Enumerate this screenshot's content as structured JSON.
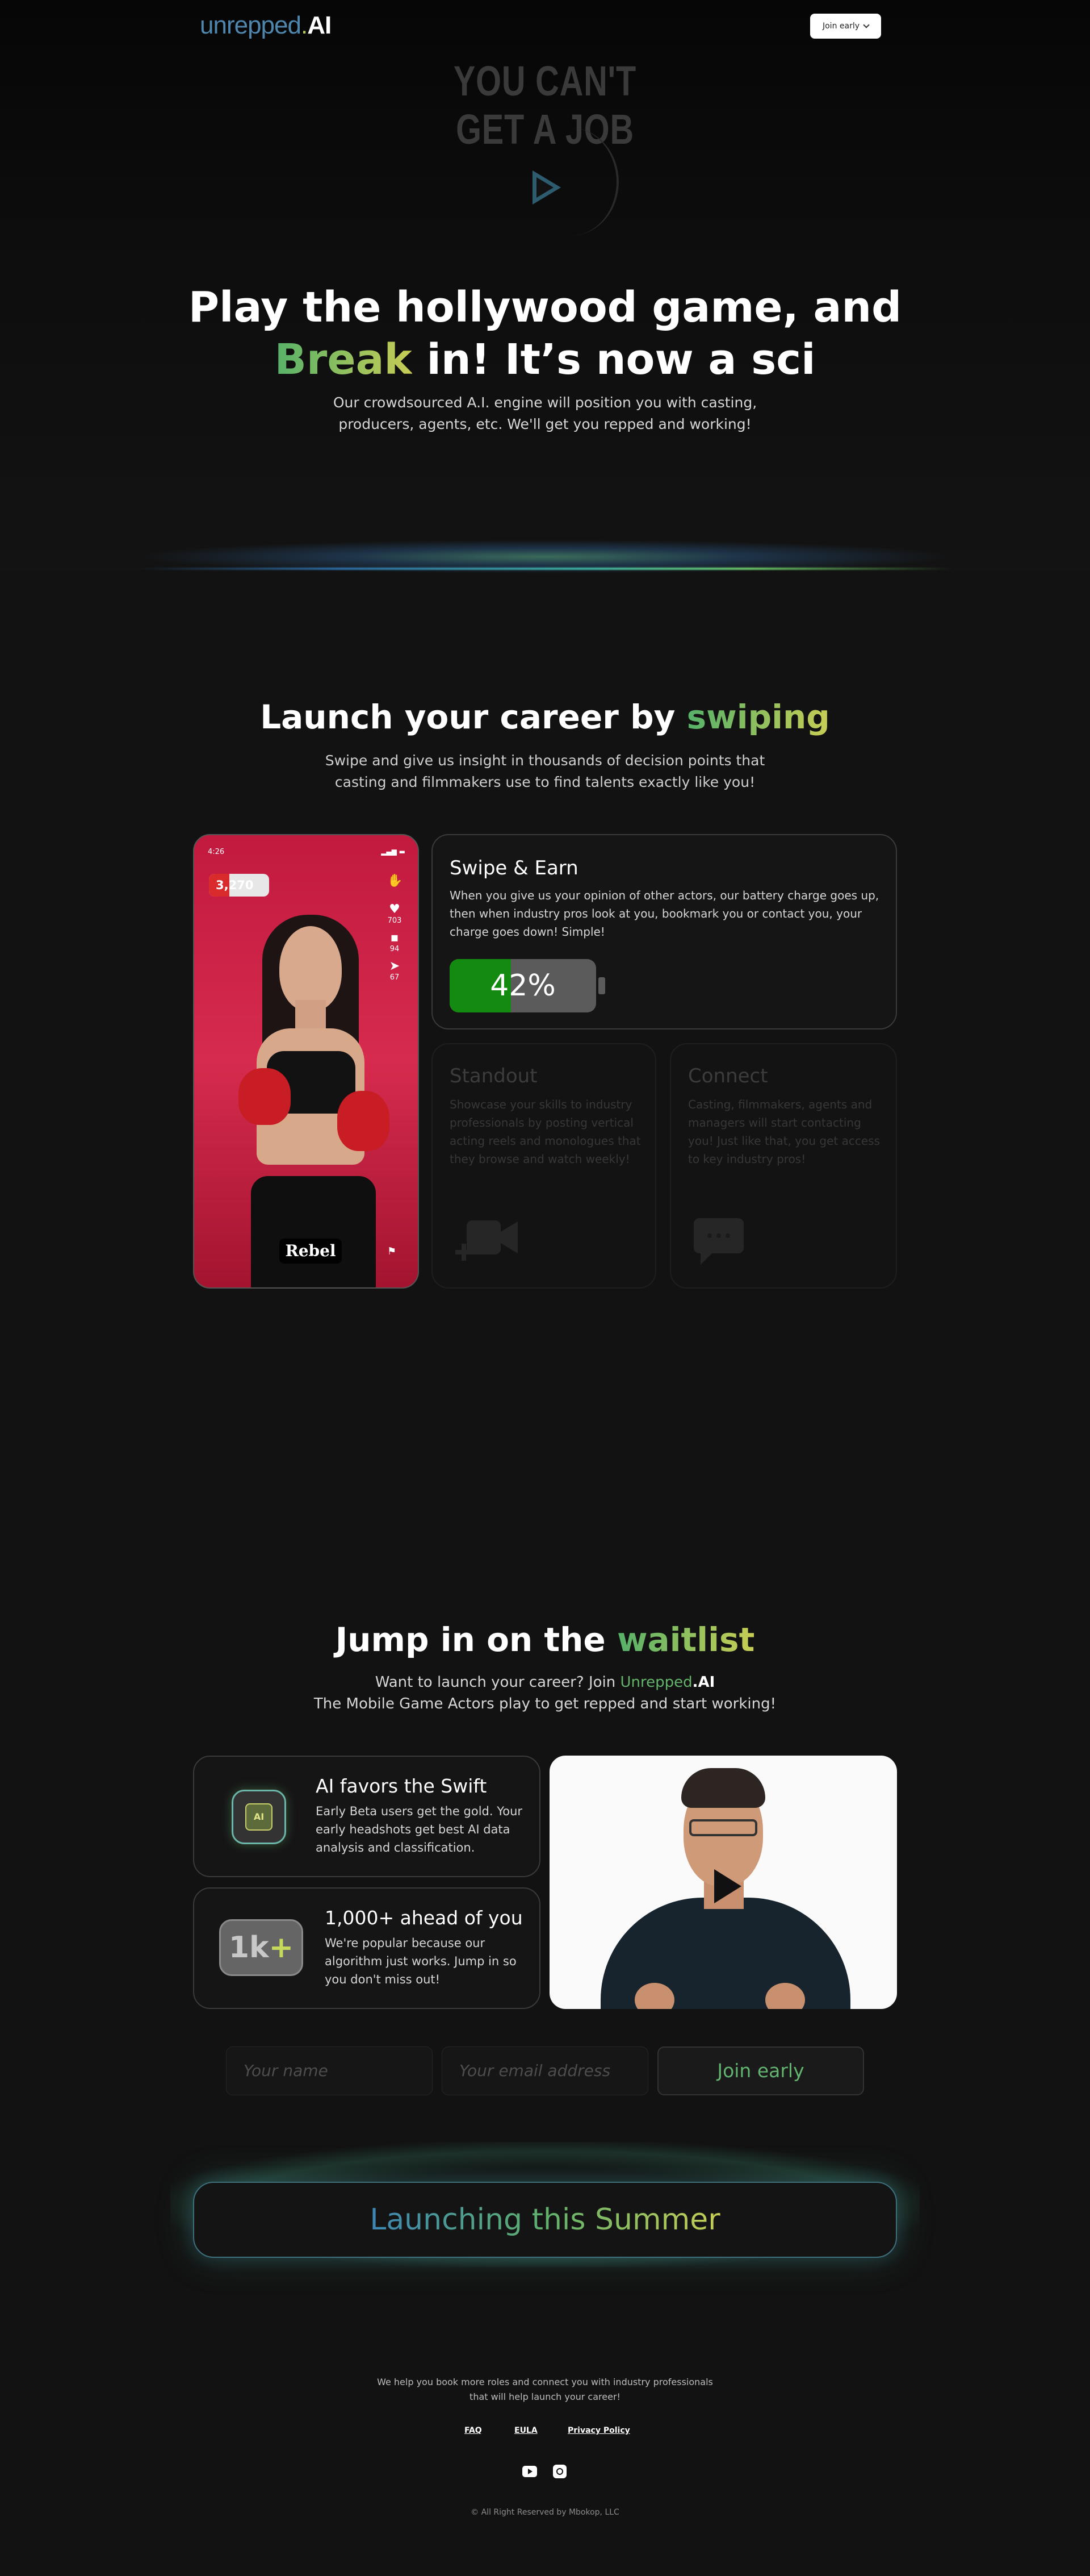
{
  "header": {
    "logo_part1": "unrepped",
    "logo_part2": ".",
    "logo_part3": "AI",
    "join_label": "Join early"
  },
  "hero": {
    "video_banner": "YOU CAN'T GET A JOB",
    "title_line1": "Play the hollywood game, and",
    "title_highlight": "Break",
    "title_line2_rest": " in! It’s now a sci",
    "subtitle": "Our crowdsourced A.I. engine will position you with casting, producers, agents, etc. We'll get you repped and working!"
  },
  "swipe_section": {
    "title_main": "Launch your career by ",
    "title_highlight": "swiping",
    "subtitle": "Swipe and give us insight in thousands of decision points that casting and filmmakers use to find talents exactly like you!",
    "phone": {
      "time": "4:26",
      "status": "▂▄▆ ▬",
      "battery_value": "3,270",
      "battery_level": 0.34,
      "likes": "703",
      "comments": "94",
      "shares": "67",
      "name": "Rebel"
    },
    "card_swipe": {
      "title": "Swipe & Earn",
      "text": "When you give us your opinion of other actors, our battery charge goes up, then when industry pros look at you, bookmark you or contact you, your charge goes down! Simple!",
      "battery_percent": "42%",
      "battery_level": 0.42
    },
    "card_standout": {
      "title": "Standout",
      "text": "Showcase your skills to industry professionals by posting vertical acting reels and monologues that they browse and watch weekly!"
    },
    "card_connect": {
      "title": "Connect",
      "text": "Casting, filmmakers, agents and managers will start contacting you! Just like that, you get access to key industry pros!"
    }
  },
  "waitlist": {
    "title_main": "Jump in on the ",
    "title_highlight": "waitlist",
    "sub_line1_pre": "Want to launch your career? Join ",
    "sub_brand1": "Unrepped",
    "sub_brand2": ".AI",
    "sub_line2": "The Mobile Game Actors play to get repped and start working!",
    "feature1": {
      "icon_text": "AI",
      "title": "AI favors the Swift",
      "text": "Early Beta users get the gold. Your early headshots get best AI data analysis and classification."
    },
    "feature2": {
      "icon_text": "1k",
      "icon_plus": "+",
      "title": "1,000+ ahead of you",
      "text": "We're popular because our algorithm just works. Jump in so you don't miss out!"
    },
    "form": {
      "name_placeholder": "Your name",
      "email_placeholder": "Your email address",
      "submit_label": "Join early"
    },
    "launch_text": "Launching this Summer"
  },
  "footer": {
    "text": "We help you book more roles and connect you with industry professionals that will help launch your career!",
    "links": [
      "FAQ",
      "EULA",
      "Privacy Policy"
    ],
    "copyright": "© All Right Reserved by Mbokop, LLC"
  }
}
